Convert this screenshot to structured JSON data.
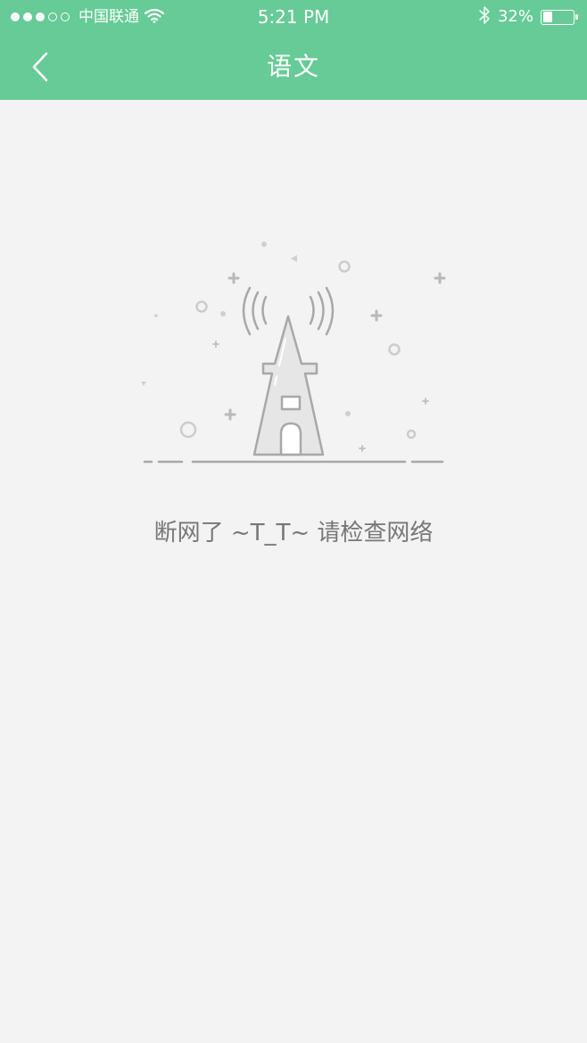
{
  "status_bar": {
    "signal_dots_filled": 3,
    "signal_dots_total": 5,
    "carrier": "中国联通",
    "time": "5:21 PM",
    "battery_percent": "32%",
    "battery_level": 0.32,
    "icons": [
      "wifi-icon",
      "bluetooth-icon",
      "battery-icon"
    ]
  },
  "nav": {
    "back_icon": "chevron-left-icon",
    "title": "语文"
  },
  "content": {
    "illustration_icon": "signal-tower-icon",
    "message": "断网了 ~T_T~ 请检查网络"
  },
  "colors": {
    "header_bg": "#66cb96",
    "page_bg": "#f3f3f3",
    "message_text": "#777777",
    "illustration_stroke": "#a8a8a8"
  }
}
